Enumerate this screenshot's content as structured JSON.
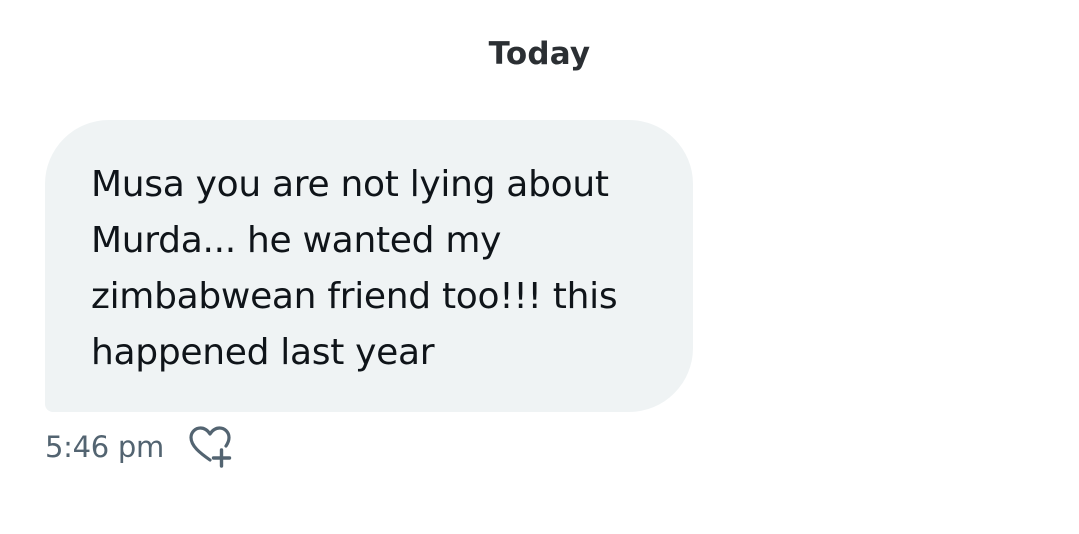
{
  "conversation": {
    "date_divider": "Today",
    "message": {
      "text": "Musa you are not lying about Murda... he wanted my zimbabwean friend too!!! this happened last year",
      "timestamp": "5:46 pm",
      "react_icon": "heart-plus-icon"
    }
  },
  "colors": {
    "bubble_background": "#eff3f4",
    "text_primary": "#0f1419",
    "text_secondary": "#536471"
  }
}
